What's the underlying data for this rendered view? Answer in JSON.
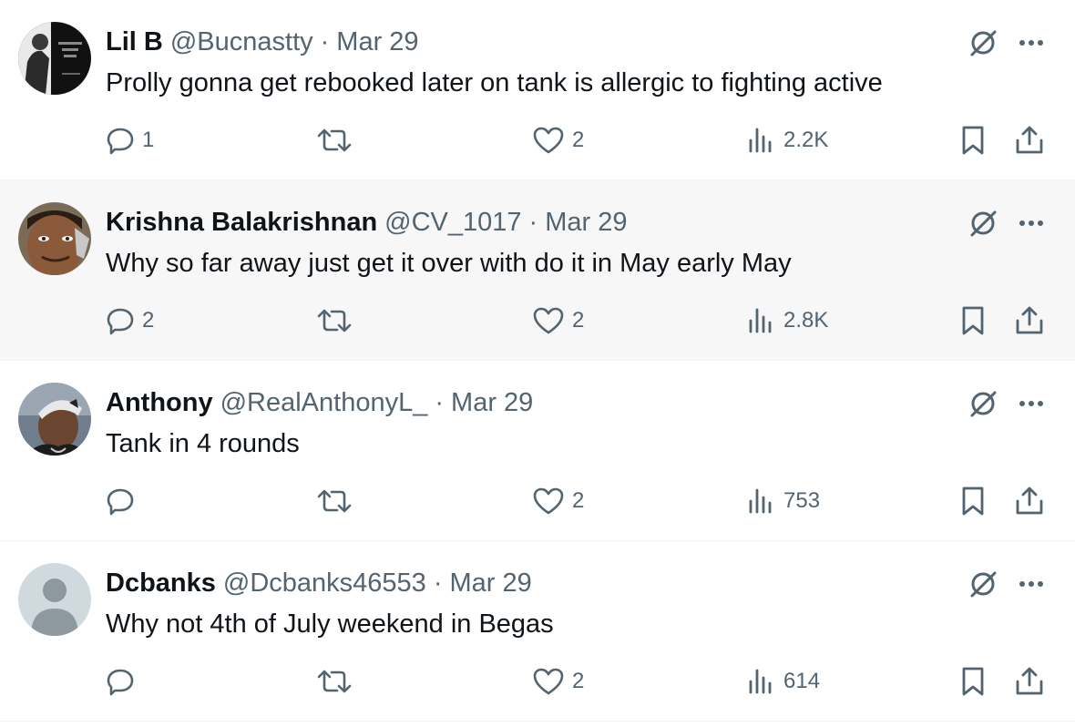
{
  "tweets": [
    {
      "name": "Lil B",
      "handle": "@Bucnastty",
      "separator": "·",
      "date": "Mar 29",
      "text": "Prolly gonna get rebooked later on tank is allergic to fighting active",
      "replies": "1",
      "retweets": "",
      "likes": "2",
      "views": "2.2K",
      "avatar": "photo-dark-monochrome"
    },
    {
      "name": "Krishna Balakrishnan",
      "handle": "@CV_1017",
      "separator": "·",
      "date": "Mar 29",
      "text": "Why so far away just get it over with do it in May early May",
      "replies": "2",
      "retweets": "",
      "likes": "2",
      "views": "2.8K",
      "avatar": "photo-face-closeup"
    },
    {
      "name": "Anthony",
      "handle": "@RealAnthonyL_",
      "separator": "·",
      "date": "Mar 29",
      "text": "Tank in 4 rounds",
      "replies": "",
      "retweets": "",
      "likes": "2",
      "views": "753",
      "avatar": "photo-person-cap"
    },
    {
      "name": "Dcbanks",
      "handle": "@Dcbanks46553",
      "separator": "·",
      "date": "Mar 29",
      "text": "Why not 4th of July weekend in Begas",
      "replies": "",
      "retweets": "",
      "likes": "2",
      "views": "614",
      "avatar": "default-silhouette"
    }
  ],
  "icons": {
    "reply": "reply-icon",
    "retweet": "retweet-icon",
    "like": "heart-icon",
    "views": "views-icon",
    "bookmark": "bookmark-icon",
    "share": "share-icon",
    "grok": "grok-icon",
    "more": "more-icon"
  },
  "colors": {
    "text_primary": "#0f1419",
    "text_secondary": "#536471",
    "divider": "#eff3f4",
    "hover_background": "#f7f7f7"
  }
}
